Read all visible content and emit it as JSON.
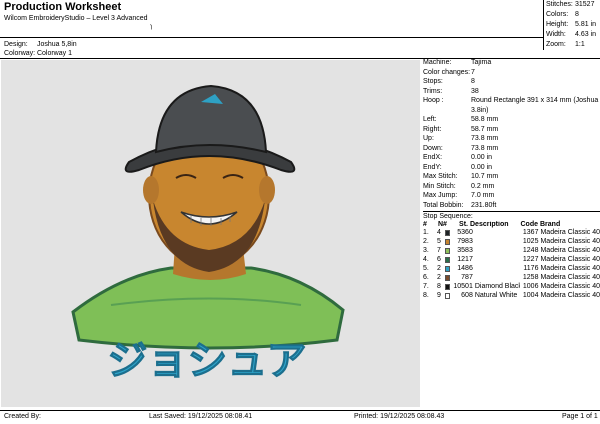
{
  "header": {
    "title": "Production Worksheet",
    "subtitle": "Wilcom EmbroideryStudio – Level 3 Advanced",
    "design_label": "Design:",
    "design_value": "Joshua 5,8in",
    "colorway_label": "Colorway:",
    "colorway_value": "Colorway 1"
  },
  "stats": [
    {
      "label": "Stitches:",
      "value": "31527"
    },
    {
      "label": "Colors:",
      "value": "8"
    },
    {
      "label": "Height:",
      "value": "5.81 in"
    },
    {
      "label": "Width:",
      "value": "4.63 in"
    },
    {
      "label": "Zoom:",
      "value": "1:1"
    }
  ],
  "design_info": [
    {
      "label": "Machine:",
      "value": "Tajima"
    },
    {
      "label": "Color changes:",
      "value": "7"
    },
    {
      "label": "Stops:",
      "value": "8"
    },
    {
      "label": "Trims:",
      "value": "38"
    },
    {
      "label": "Hoop :",
      "value": "Round Rectangle 391 x 314 mm (Joshua 3.8in)"
    },
    {
      "label": "Left:",
      "value": "58.8 mm"
    },
    {
      "label": "Right:",
      "value": "58.7 mm"
    },
    {
      "label": "Up:",
      "value": "73.8 mm"
    },
    {
      "label": "Down:",
      "value": "73.8 mm"
    },
    {
      "label": "EndX:",
      "value": "0.00 in"
    },
    {
      "label": "EndY:",
      "value": "0.00 in"
    },
    {
      "label": "Max Stitch:",
      "value": "10.7 mm"
    },
    {
      "label": "Min Stitch:",
      "value": "0.2 mm"
    },
    {
      "label": "Max Jump:",
      "value": "7.0 mm"
    },
    {
      "label": "Total Bobbin:",
      "value": "231.80ft"
    }
  ],
  "stop_sequence": {
    "title": "Stop Sequence:",
    "headers": {
      "num": "#",
      "n": "N#",
      "st": "St.",
      "desc": "Description",
      "code": "Code",
      "brand": "Brand"
    },
    "rows": [
      {
        "num": "1.",
        "n": "4",
        "color": "#1f2326",
        "st": "5360",
        "desc": "",
        "code": "1367",
        "brand": "Madeira Classic 40"
      },
      {
        "num": "2.",
        "n": "5",
        "color": "#c6842f",
        "st": "7983",
        "desc": "",
        "code": "1025",
        "brand": "Madeira Classic 40"
      },
      {
        "num": "3.",
        "n": "7",
        "color": "#8fc15a",
        "st": "3583",
        "desc": "",
        "code": "1248",
        "brand": "Madeira Classic 40"
      },
      {
        "num": "4.",
        "n": "6",
        "color": "#2a6e4a",
        "st": "1217",
        "desc": "",
        "code": "1227",
        "brand": "Madeira Classic 40"
      },
      {
        "num": "5.",
        "n": "2",
        "color": "#2ea1c4",
        "st": "1486",
        "desc": "",
        "code": "1176",
        "brand": "Madeira Classic 40"
      },
      {
        "num": "6.",
        "n": "2",
        "color": "#7a4a2a",
        "st": "787",
        "desc": "",
        "code": "1258",
        "brand": "Madeira Classic 40"
      },
      {
        "num": "7.",
        "n": "8",
        "color": "#111111",
        "st": "10501",
        "desc": "Diamond Black",
        "code": "1006",
        "brand": "Madeira Classic 40"
      },
      {
        "num": "8.",
        "n": "9",
        "color": "#ffffff",
        "st": "608",
        "desc": "Natural White",
        "code": "1004",
        "brand": "Madeira Classic 40"
      }
    ]
  },
  "artwork": {
    "text": "ジョシュア",
    "text_color": "#2fa6cc"
  },
  "footer": {
    "created_by": "Created By:",
    "last_saved": "Last Saved: 19/12/2025 08:08.41",
    "printed": "Printed: 19/12/2025 08:08.43",
    "page": "Page 1 of 1"
  }
}
